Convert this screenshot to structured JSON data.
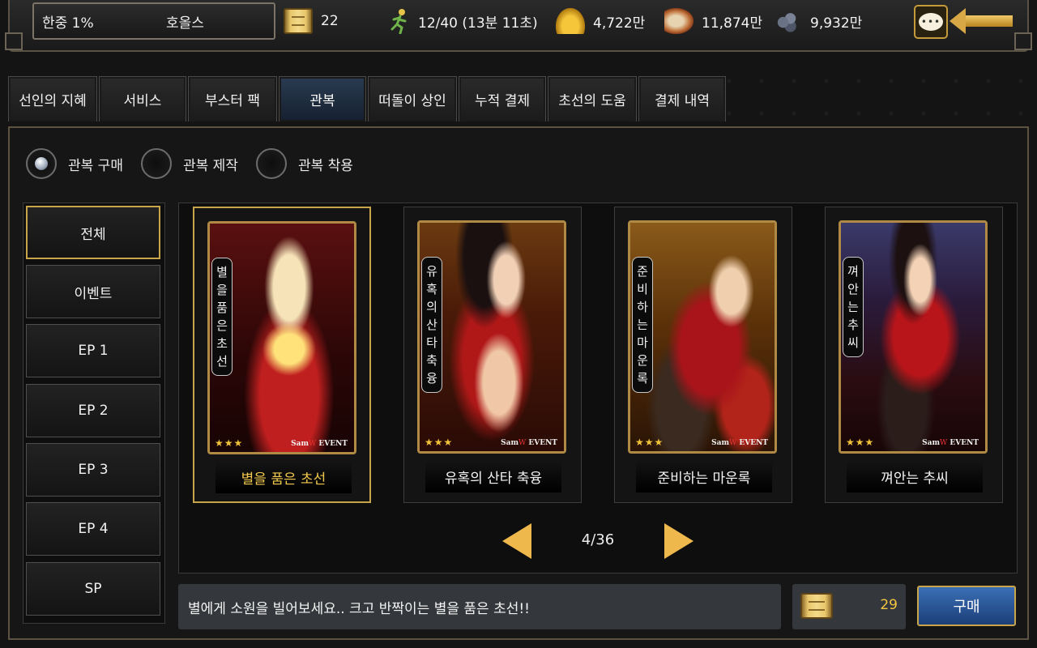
{
  "header": {
    "server": "한중 1%",
    "player_name": "호올스",
    "scroll_count": "22",
    "stamina": "12/40 (13분 11초)",
    "gold": "4,722만",
    "food": "11,874만",
    "iron": "9,932만"
  },
  "tabs": [
    {
      "label": "선인의 지혜"
    },
    {
      "label": "서비스"
    },
    {
      "label": "부스터 팩"
    },
    {
      "label": "관복"
    },
    {
      "label": "떠돌이 상인"
    },
    {
      "label": "누적 결제"
    },
    {
      "label": "초선의 도움"
    },
    {
      "label": "결제 내역"
    }
  ],
  "radio": [
    {
      "label": "관복 구매",
      "checked": true
    },
    {
      "label": "관복 제작",
      "checked": false
    },
    {
      "label": "관복 착용",
      "checked": false
    }
  ],
  "categories": [
    {
      "label": "전체"
    },
    {
      "label": "이벤트"
    },
    {
      "label": "EP 1"
    },
    {
      "label": "EP 2"
    },
    {
      "label": "EP 3"
    },
    {
      "label": "EP 4"
    },
    {
      "label": "SP"
    }
  ],
  "cards": [
    {
      "vertical_title": "별을 품은 초선",
      "name": "별을 품은 초선",
      "stars": "★★★",
      "brand_a": "Sam",
      "brand_w": "W",
      "brand_b": " EVENT"
    },
    {
      "vertical_title": "유혹의 산타 축융",
      "name": "유혹의 산타 축융",
      "stars": "★★★",
      "brand_a": "Sam",
      "brand_w": "W",
      "brand_b": " EVENT"
    },
    {
      "vertical_title": "준비하는 마운록",
      "name": "준비하는 마운록",
      "stars": "★★★",
      "brand_a": "Sam",
      "brand_w": "W",
      "brand_b": " EVENT"
    },
    {
      "vertical_title": "껴안는 추씨",
      "name": "껴안는 추씨",
      "stars": "★★★",
      "brand_a": "Sam",
      "brand_w": "W",
      "brand_b": " EVENT"
    }
  ],
  "pager": {
    "text": "4/36"
  },
  "footer": {
    "description": "별에게 소원을 빌어보세요.. 크고 반짝이는 별을 품은 초선!!",
    "price": "29",
    "buy_label": "구매"
  },
  "colors": {
    "accent_gold": "#c8a44a",
    "price_yellow": "#f4c440",
    "buy_blue": "#2b5598"
  }
}
